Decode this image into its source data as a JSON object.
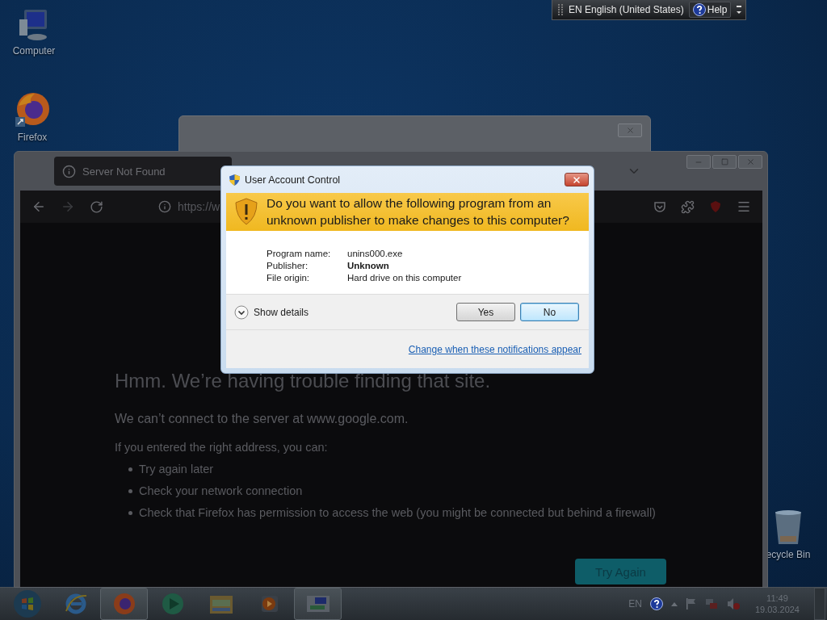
{
  "desktop_icons": [
    {
      "label": "Computer",
      "kind": "computer"
    },
    {
      "label": "Firefox",
      "kind": "firefox"
    },
    {
      "label": "ecycle Bin",
      "kind": "recycle"
    }
  ],
  "language_bar": {
    "language": "EN English (United States)",
    "help": "Help"
  },
  "browser": {
    "tab": {
      "title": "Server Not Found"
    },
    "address": "https://w",
    "page": {
      "title": "Hmm. We’re having trouble finding that site.",
      "message": "We can’t connect to the server at www.google.com.",
      "hint": "If you entered the right address, you can:",
      "suggestions": [
        "Try again later",
        "Check your network connection",
        "Check that Firefox has permission to access the web (you might be connected but behind a firewall)"
      ],
      "button": "Try Again"
    }
  },
  "dialog": {
    "title": "User Account Control",
    "question": "Do you want to allow the following program from an unknown publisher to make changes to this computer?",
    "details": [
      {
        "label": "Program name:",
        "value": "unins000.exe",
        "emphasis": false
      },
      {
        "label": "Publisher:",
        "value": "Unknown",
        "emphasis": true
      },
      {
        "label": "File origin:",
        "value": "Hard drive on this computer",
        "emphasis": false
      }
    ],
    "show_details": "Show details",
    "buttons": [
      {
        "label": "Yes",
        "selected": false
      },
      {
        "label": "No",
        "selected": true
      }
    ],
    "link": "Change when these notifications appear"
  },
  "taskbar": {
    "apps": [
      {
        "kind": "start",
        "running": false
      },
      {
        "kind": "ie",
        "running": false
      },
      {
        "kind": "firefox",
        "running": true
      },
      {
        "kind": "media",
        "running": false
      },
      {
        "kind": "explorer",
        "running": false
      },
      {
        "kind": "player",
        "running": false
      },
      {
        "kind": "display",
        "running": true
      }
    ],
    "tray": {
      "language": "EN",
      "time": "11:49",
      "date": "19.03.2024"
    }
  }
}
